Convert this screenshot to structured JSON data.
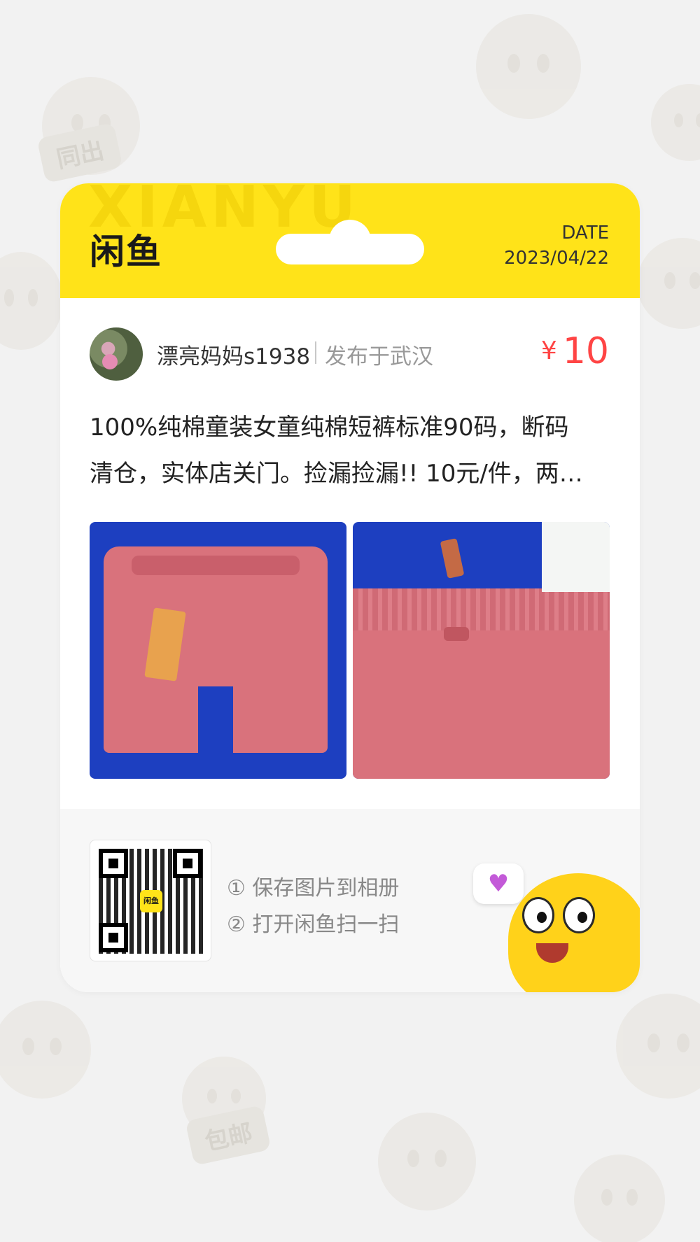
{
  "header": {
    "logo": "闲鱼",
    "watermark": "XIANYU",
    "date_label": "DATE",
    "date_value": "2023/04/22"
  },
  "seller": {
    "name": "漂亮妈妈s1938",
    "location": "发布于武汉"
  },
  "price": {
    "currency": "¥",
    "value": "10"
  },
  "description": {
    "line1": "100%纯棉童装女童纯棉短裤标准90码，断码",
    "line2": "清仓，实体店关门。捡漏捡漏!! 10元/件，两…"
  },
  "photos": [
    {
      "icon": "pink-shorts-photo"
    },
    {
      "icon": "pink-shorts-waistband-photo"
    }
  ],
  "footer": {
    "qr_logo": "闲鱼",
    "step1": "① 保存图片到相册",
    "step2": "② 打开闲鱼扫一扫",
    "bubble_icon": "heart-icon",
    "bubble_glyph": "♥"
  },
  "background_tags": [
    "同出",
    "包邮"
  ],
  "colors": {
    "accent_yellow": "#ffe319",
    "price_red": "#ff4444",
    "text_dark": "#222222",
    "text_muted": "#999999"
  }
}
